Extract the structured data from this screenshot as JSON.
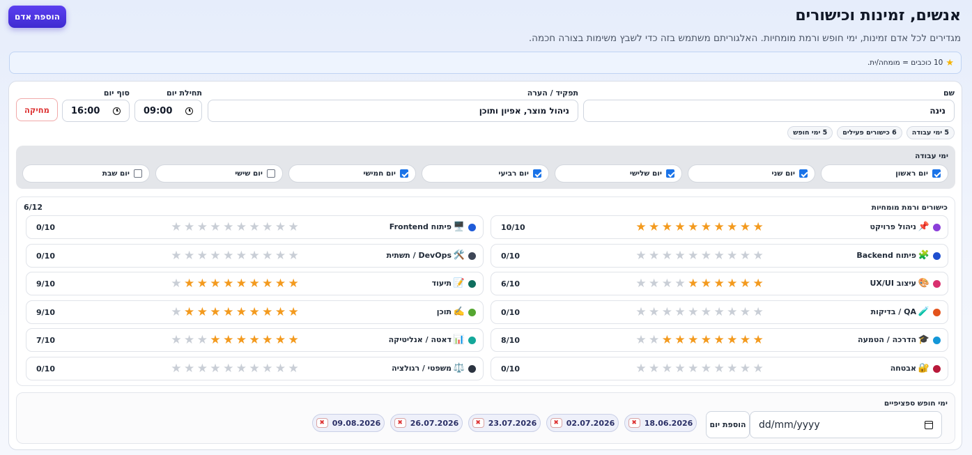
{
  "header": {
    "title": "אנשים, זמינות וכישורים",
    "subtitle": "מגדירים לכל אדם זמינות, ימי חופש ורמת מומחיות. האלגוריתם משתמש בזה כדי לשבץ משימות בצורה חכמה.",
    "add_person_label": "הוספת אדם"
  },
  "legend": {
    "icon": "star-icon",
    "text": "10 כוכבים = מומחה/ית."
  },
  "person": {
    "name_label": "שם",
    "name_value": "נינה",
    "role_label": "תפקיד / הערה",
    "role_value": "ניהול מוצר, אפיון ותוכן",
    "start_label": "תחילת יום",
    "start_value": "09:00",
    "end_label": "סוף יום",
    "end_value": "16:00",
    "delete_label": "מחיקה",
    "stats": [
      "5 ימי עבודה",
      "6 כישורים פעילים",
      "5 ימי חופש"
    ]
  },
  "workdays": {
    "title": "ימי עבודה",
    "days": [
      {
        "label": "יום ראשון",
        "checked": true
      },
      {
        "label": "יום שני",
        "checked": true
      },
      {
        "label": "יום שלישי",
        "checked": true
      },
      {
        "label": "יום רביעי",
        "checked": true
      },
      {
        "label": "יום חמישי",
        "checked": true
      },
      {
        "label": "יום שישי",
        "checked": false
      },
      {
        "label": "יום שבת",
        "checked": false
      }
    ]
  },
  "skills": {
    "title": "כישורים ורמת מומחיות",
    "counter": "6/12",
    "max": 10,
    "items": [
      {
        "emoji": "📌",
        "label": "ניהול פרויקט",
        "color": "#8b3fd9",
        "level": 10,
        "score": "10/10"
      },
      {
        "emoji": "🖥️",
        "label": "פיתוח Frontend",
        "color": "#1f5bd8",
        "level": 0,
        "score": "0/10"
      },
      {
        "emoji": "🧩",
        "label": "פיתוח Backend",
        "color": "#1f4fcf",
        "level": 0,
        "score": "0/10"
      },
      {
        "emoji": "🛠️",
        "label": "DevOps / תשתית",
        "color": "#3d4656",
        "level": 0,
        "score": "0/10"
      },
      {
        "emoji": "🎨",
        "label": "עיצוב UX/UI",
        "color": "#d9306f",
        "level": 6,
        "score": "6/10"
      },
      {
        "emoji": "📝",
        "label": "תיעוד",
        "color": "#0f6e5e",
        "level": 9,
        "score": "9/10"
      },
      {
        "emoji": "🧪",
        "label": "QA / בדיקות",
        "color": "#e3531c",
        "level": 0,
        "score": "0/10"
      },
      {
        "emoji": "✍️",
        "label": "תוכן",
        "color": "#55a631",
        "level": 9,
        "score": "9/10"
      },
      {
        "emoji": "🎓",
        "label": "הדרכה / הטמעה",
        "color": "#1497d8",
        "level": 8,
        "score": "8/10"
      },
      {
        "emoji": "📊",
        "label": "דאטה / אנליטיקה",
        "color": "#14a89a",
        "level": 7,
        "score": "7/10"
      },
      {
        "emoji": "🔐",
        "label": "אבטחה",
        "color": "#b8193a",
        "level": 0,
        "score": "0/10"
      },
      {
        "emoji": "⚖️",
        "label": "משפטי / רגולציה",
        "color": "#2b3340",
        "level": 0,
        "score": "0/10"
      }
    ]
  },
  "vacation": {
    "title": "ימי חופש ספציפיים",
    "date_placeholder": "dd/mm/yyyy",
    "add_day_label": "הוספת יום",
    "remove_icon": "✖",
    "dates": [
      "18.06.2026",
      "02.07.2026",
      "23.07.2026",
      "26.07.2026",
      "09.08.2026"
    ]
  },
  "colors": {
    "accent": "#4a34e0",
    "star_on": "#f39a1e",
    "star_off": "#c9ced6",
    "checkbox": "#1a73e8"
  }
}
